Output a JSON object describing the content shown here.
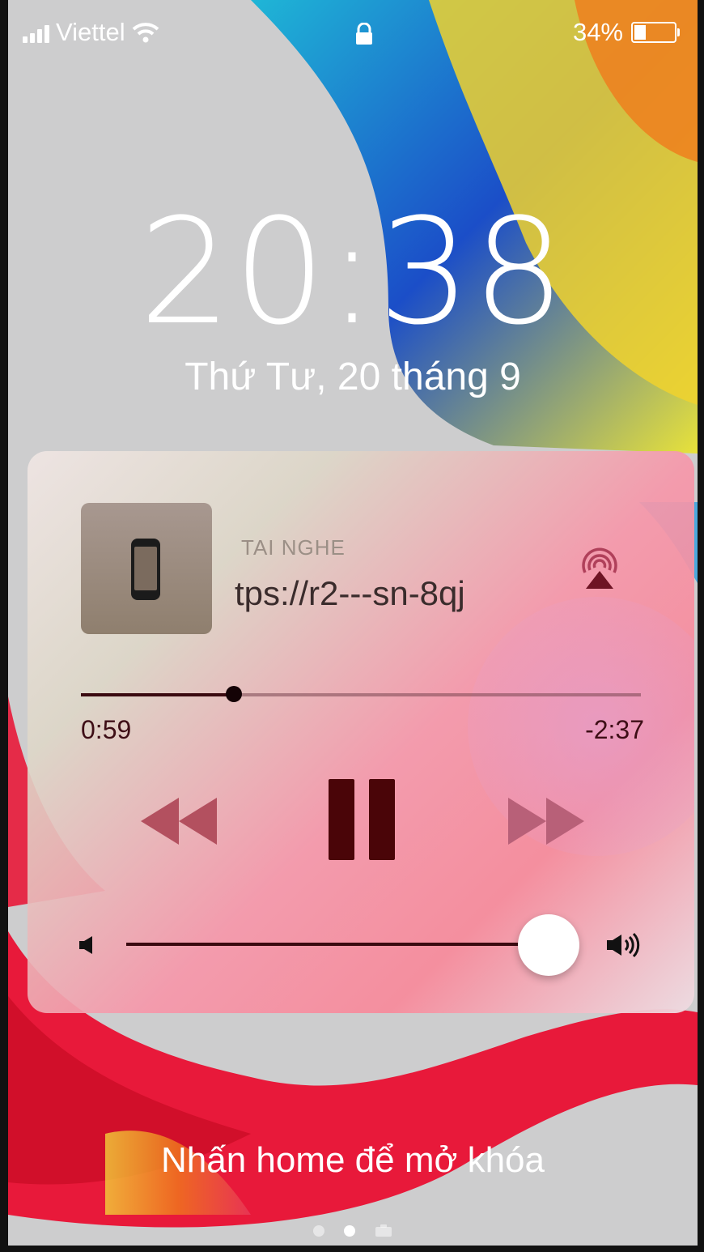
{
  "status_bar": {
    "carrier": "Viettel",
    "battery_percent": "34%",
    "battery_level": 0.34,
    "icons": [
      "signal-icon",
      "wifi-icon",
      "lock-icon",
      "battery-icon"
    ]
  },
  "lock_screen": {
    "time": "20:38",
    "date": "Thứ Tư, 20 tháng 9",
    "unlock_hint": "Nhấn home để mở khóa",
    "page_indicator": {
      "count": 3,
      "active_index": 1,
      "last_is_camera": true
    }
  },
  "now_playing": {
    "route_label": "TAI NGHE",
    "title": "tps://r2---sn-8qj",
    "artwork_icon": "phone-icon",
    "airplay_icon": "airplay-icon",
    "elapsed": "0:59",
    "remaining": "-2:37",
    "progress": 0.273,
    "volume": 0.84,
    "controls": [
      "rewind-icon",
      "pause-icon",
      "fast-forward-icon"
    ],
    "colors": {
      "accent_dark": "#3a0a10",
      "airplay": "#b0405a"
    }
  }
}
